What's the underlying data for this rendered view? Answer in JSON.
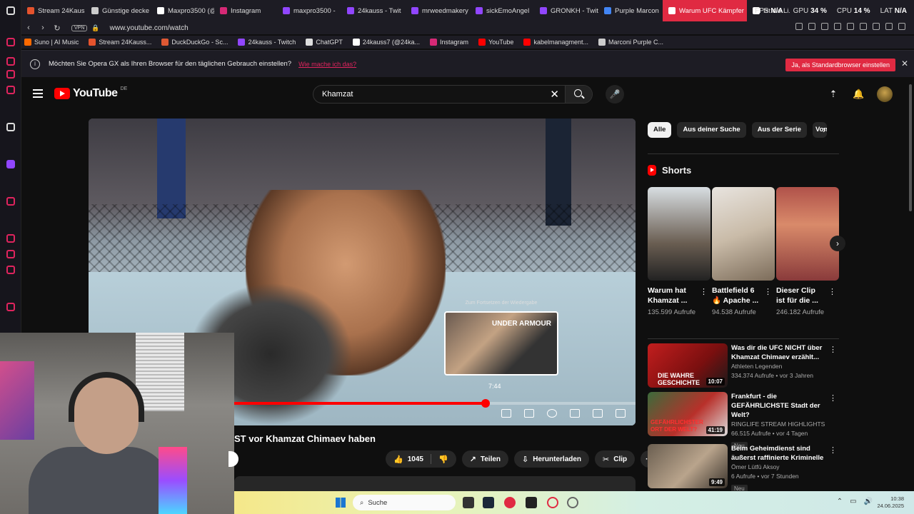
{
  "tabs": [
    {
      "label": "Stream 24Kaus",
      "color": "#e5532d"
    },
    {
      "label": "Günstige decke",
      "color": "#cccccc"
    },
    {
      "label": "Maxpro3500 (@",
      "color": "#ffffff"
    },
    {
      "label": "Instagram",
      "color": "#d62976"
    },
    {
      "label": "maxpro3500 -",
      "color": "#9146ff"
    },
    {
      "label": "24kauss - Twit",
      "color": "#9146ff"
    },
    {
      "label": "mrweedmakery",
      "color": "#9146ff"
    },
    {
      "label": "sickEmoAngel",
      "color": "#9146ff"
    },
    {
      "label": "GRONKH - Twit",
      "color": "#9146ff"
    },
    {
      "label": "Purple Marcon",
      "color": "#4285f4"
    },
    {
      "label": "Warum UFC Kämpfer",
      "color": "#ffffff"
    },
    {
      "label": "Ist die Li...",
      "color": "#ffffff"
    }
  ],
  "stats": {
    "fps_label": "FPS",
    "fps": "N/A",
    "gpu_label": "GPU",
    "gpu": "34 %",
    "cpu_label": "CPU",
    "cpu": "14 %",
    "lat_label": "LAT",
    "lat": "N/A"
  },
  "address": {
    "vpn": "VPN",
    "url": "www.youtube.com/watch"
  },
  "bookmarks": [
    {
      "label": "Suno | AI Music",
      "color": "#ff6a00"
    },
    {
      "label": "Stream 24Kauss...",
      "color": "#e5532d"
    },
    {
      "label": "DuckDuckGo - Sc...",
      "color": "#de5833"
    },
    {
      "label": "24kauss - Twitch",
      "color": "#9146ff"
    },
    {
      "label": "ChatGPT",
      "color": "#dddddd"
    },
    {
      "label": "24kauss7 (@24ka...",
      "color": "#ffffff"
    },
    {
      "label": "Instagram",
      "color": "#d62976"
    },
    {
      "label": "YouTube",
      "color": "#ff0000"
    },
    {
      "label": "kabelmanagment...",
      "color": "#ff0000"
    },
    {
      "label": "Marconi Purple C...",
      "color": "#cccccc"
    }
  ],
  "notification": {
    "text": "Möchten Sie Opera GX als Ihren Browser für den täglichen Gebrauch einstellen?",
    "link": "Wie mache ich das?",
    "cta": "Ja, als Standardbrowser einstellen",
    "close": "✕"
  },
  "youtube": {
    "logo": "YouTube",
    "region": "DE",
    "search_query": "Khamzat",
    "clear": "✕",
    "mic": "🎤"
  },
  "player": {
    "hover_caption": "Zum Fortsetzen der Wiedergabe",
    "hover_brand": "UNDER ARMOUR",
    "hover_time": "7:44",
    "progress": 0.726
  },
  "video": {
    "title": "ST vor Khamzat Chimaev haben",
    "likes": "1045",
    "share": "Teilen",
    "download": "Herunterladen",
    "clip": "Clip",
    "more": "···"
  },
  "chips": [
    "Alle",
    "Aus deiner Suche",
    "Aus der Serie",
    "Von"
  ],
  "shorts_label": "Shorts",
  "shorts": [
    {
      "title": "Warum hat Khamzat ...",
      "views": "135.599 Aufrufe",
      "bg": "linear-gradient(180deg,#d8dee2,#6a5e52 60%,#222)"
    },
    {
      "title": "Battlefield 6 🔥 Apache ...",
      "views": "94.538 Aufrufe",
      "bg": "linear-gradient(160deg,#e8e4df,#c9bba8 50%,#7c6c5a)"
    },
    {
      "title": "Dieser Clip ist für die ...",
      "views": "246.182 Aufrufe",
      "bg": "linear-gradient(180deg,#b0524a,#d98a6a 40%,#8a3b3b)"
    }
  ],
  "recommended": [
    {
      "title": "Was dir die UFC NICHT über Khamzat Chimaev erzählt...",
      "channel": "Athleten Legenden",
      "meta": "334.374 Aufrufe • vor 3 Jahren",
      "duration": "10:07",
      "badge": "",
      "thumb_text": "DIE WAHRE GESCHICHTE",
      "bg": "linear-gradient(135deg,#c21e1e,#7a0f0f 60%,#1a1a1a)"
    },
    {
      "title": "Frankfurt - die GEFÄHRLICHSTE Stadt der Welt?",
      "channel": "RINGLIFE STREAM HIGHLIGHTS",
      "meta": "66.515 Aufrufe • vor 4 Tagen",
      "duration": "41:19",
      "badge": "Neu",
      "thumb_text": "GEFÄHRLICHSTER ORT DER WELT?",
      "bg": "linear-gradient(135deg,#3b6b3b,#b8302a 55%,#dcdcdc)"
    },
    {
      "title": "Beim Geheimdienst sind äußerst raffinierte Kriminelle",
      "channel": "Ömer Lütfü Aksoy",
      "meta": "6 Aufrufe • vor 7 Stunden",
      "duration": "9:49",
      "badge": "Neu",
      "thumb_text": "",
      "bg": "linear-gradient(135deg,#6a5e50,#b9a48c 55%,#3a332c)"
    }
  ],
  "taskbar": {
    "search": "Suche",
    "time": "10:38",
    "date": "24.06.2025"
  }
}
